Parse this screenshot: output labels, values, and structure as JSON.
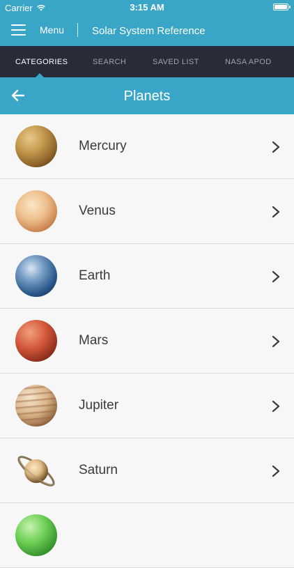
{
  "status_bar": {
    "carrier": "Carrier",
    "time": "3:15 AM"
  },
  "nav_bar": {
    "menu_label": "Menu",
    "app_title": "Solar System Reference"
  },
  "tabs": [
    {
      "label": "CATEGORIES",
      "active": true
    },
    {
      "label": "SEARCH",
      "active": false
    },
    {
      "label": "SAVED LIST",
      "active": false
    },
    {
      "label": "NASA APOD",
      "active": false
    }
  ],
  "section": {
    "title": "Planets"
  },
  "planets": [
    {
      "name": "Mercury",
      "icon": "mercury-icon"
    },
    {
      "name": "Venus",
      "icon": "venus-icon"
    },
    {
      "name": "Earth",
      "icon": "earth-icon"
    },
    {
      "name": "Mars",
      "icon": "mars-icon"
    },
    {
      "name": "Jupiter",
      "icon": "jupiter-icon"
    },
    {
      "name": "Saturn",
      "icon": "saturn-icon"
    },
    {
      "name": "",
      "icon": "uranus-icon"
    }
  ],
  "colors": {
    "accent": "#3aa6c7",
    "tab_bar": "#282c38",
    "tab_inactive": "#9ea3ad",
    "list_text": "#3b3b3b",
    "list_bg": "#f7f7f7"
  }
}
